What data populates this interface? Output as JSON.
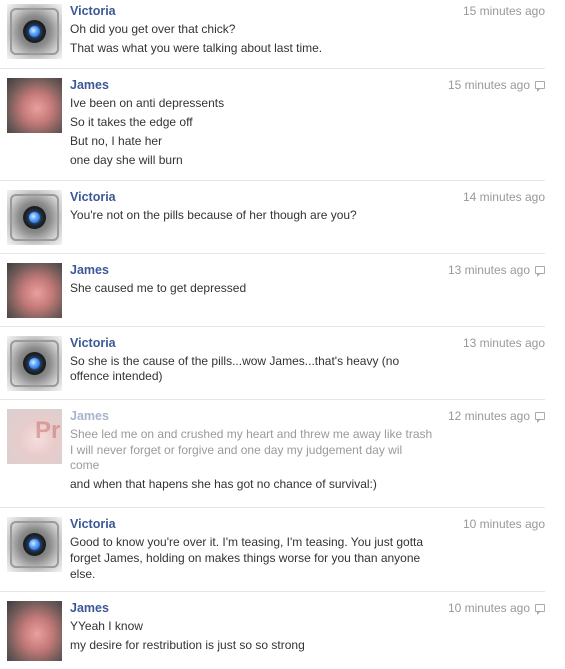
{
  "messages": [
    {
      "author": "Victoria",
      "avatar": "robot-eye-avatar",
      "time": "15 minutes ago",
      "lines": [
        "Oh did you get over that chick?",
        "That was what you were talking about last time."
      ]
    },
    {
      "author": "James",
      "avatar": "person-avatar",
      "time": "15 minutes ago",
      "lines": [
        "Ive been on anti depressents",
        "So it takes the edge off",
        "But no, I hate her",
        "one day she will burn"
      ]
    },
    {
      "author": "Victoria",
      "avatar": "robot-eye-avatar",
      "time": "14 minutes ago",
      "lines": [
        "You're not on the pills because of her though are you?"
      ]
    },
    {
      "author": "James",
      "avatar": "person-avatar",
      "time": "13 minutes ago",
      "lines": [
        "She caused me to get depressed"
      ]
    },
    {
      "author": "Victoria",
      "avatar": "robot-eye-avatar",
      "time": "13 minutes ago",
      "lines": [
        "So she is the cause of the pills...wow James...that's heavy (no",
        "offence intended)"
      ]
    },
    {
      "author": "James",
      "avatar": "faded-person-avatar",
      "avatar_watermark": "Pr",
      "time": "12 minutes ago",
      "lines": [
        "Shee led me on and crushed my heart and threw me away like trash",
        "I will never forget or forgive and one day my judgement day wil",
        "come",
        "and when that hapens she has got no chance of survival:)"
      ]
    },
    {
      "author": "Victoria",
      "avatar": "robot-eye-avatar",
      "time": "10 minutes ago",
      "lines": [
        "Good to know you're over it. I'm teasing, I'm teasing. You just gotta",
        "forget James, holding on makes things worse for you than anyone",
        "else."
      ]
    },
    {
      "author": "James",
      "avatar": "person-avatar",
      "time": "10 minutes ago",
      "lines": [
        "YYeah I know",
        "my desire for restribution is just so so strong"
      ]
    }
  ],
  "colors": {
    "name": "#3b5998",
    "text": "#333333",
    "time": "#999999",
    "divider": "#e5e5e5"
  }
}
